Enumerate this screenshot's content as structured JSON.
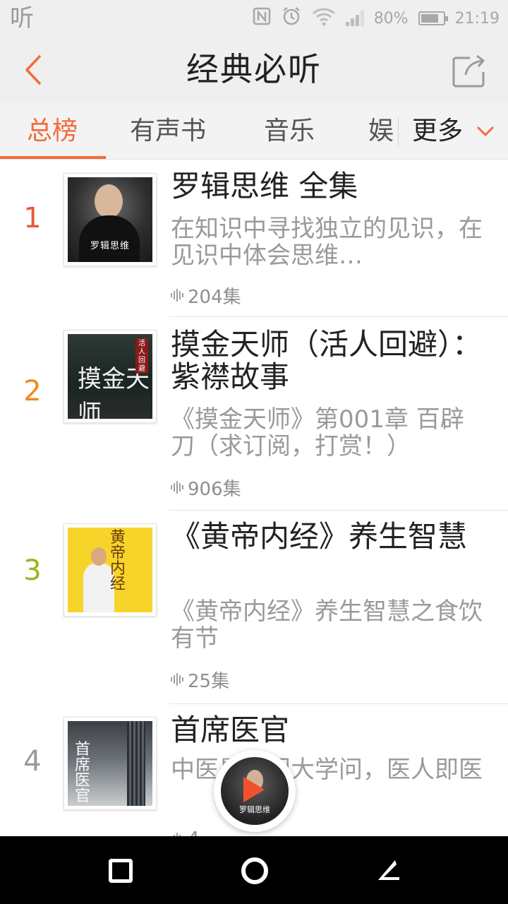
{
  "status_bar": {
    "app_icon": "听",
    "icons": [
      "nfc-icon",
      "alarm-icon",
      "wifi-icon",
      "signal-icon"
    ],
    "battery_percent": "80%",
    "battery_level": 0.8,
    "time": "21:19"
  },
  "header": {
    "title": "经典必听",
    "back_icon": "chevron-left-icon",
    "share_icon": "share-icon"
  },
  "tabs": {
    "items": [
      "总榜",
      "有声书",
      "音乐",
      "娱"
    ],
    "active_index": 0,
    "more_label": "更多",
    "accent_color": "#f26b3a"
  },
  "list": {
    "items": [
      {
        "rank": "1",
        "rank_color": "#e8593a",
        "title": "罗辑思维 全集",
        "desc": "在知识中寻找独立的见识，在见识中体会思维…",
        "count": "204集",
        "cover_text": "罗辑思维"
      },
      {
        "rank": "2",
        "rank_color": "#f08a1c",
        "title": "摸金天师（活人回避）：紫襟故事",
        "desc": "《摸金天师》第001章 百辟刀（求订阅，打赏！）",
        "count": "906集",
        "cover_text": "摸金天师",
        "cover_seal": "活人回避"
      },
      {
        "rank": "3",
        "rank_color": "#9bb21d",
        "title": "《黄帝内经》养生智慧",
        "desc": "《黄帝内经》养生智慧之食饮有节",
        "count": "25集",
        "cover_text": "黄帝内经"
      },
      {
        "rank": "4",
        "rank_color": "#9a9a9a",
        "title": "首席医官",
        "desc": "中医是一门大学问，医人即医",
        "count": "4",
        "cover_text": "首席医官"
      }
    ]
  },
  "player": {
    "label": "罗辑思维",
    "play_icon": "play-icon",
    "play_color": "#f0522e"
  },
  "nav_bar": {
    "icons": [
      "recent-apps-icon",
      "home-icon",
      "back-icon"
    ]
  }
}
